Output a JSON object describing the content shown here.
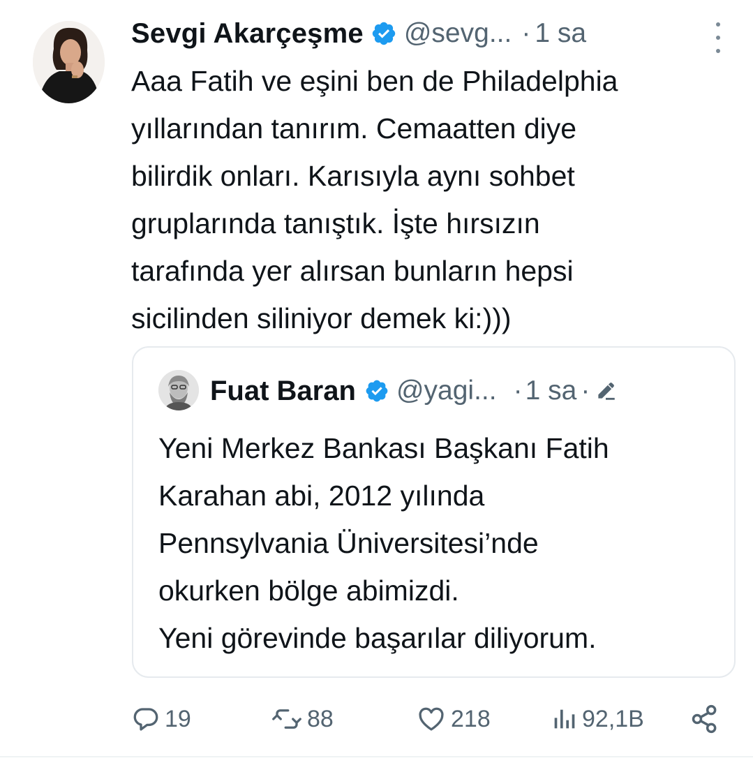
{
  "tweet": {
    "author_name": "Sevgi Akarçeşme",
    "author_handle": "@sevg...",
    "separator": "·",
    "time": "1 sa",
    "text_lines": [
      "Aaa Fatih ve eşini ben de Philadelphia",
      "yıllarından tanırım. Cemaatten diye",
      "bilirdik onları. Karısıyla aynı sohbet",
      "gruplarında tanıştık. İşte hırsızın",
      "tarafında yer alırsan bunların hepsi",
      "sicilinden siliniyor demek ki:)))"
    ],
    "icons": {
      "verified": "verified-badge-icon",
      "more": "more-options-icon"
    }
  },
  "quoted_tweet": {
    "author_name": "Fuat Baran",
    "author_handle": "@yagi...",
    "separator": "·",
    "time": "1 sa",
    "separator2": "·",
    "text_lines": [
      "Yeni Merkez Bankası Başkanı Fatih",
      "Karahan abi, 2012 yılında",
      "Pennsylvania Üniversitesi’nde",
      "okurken bölge abimizdi.",
      "Yeni görevinde başarılar diliyorum."
    ],
    "icons": {
      "verified": "verified-badge-icon",
      "edited": "edit-pencil-icon"
    }
  },
  "actions": {
    "replies": "19",
    "reposts": "88",
    "likes": "218",
    "views": "92,1B",
    "icons": [
      "reply-icon",
      "repost-icon",
      "like-icon",
      "views-icon",
      "share-icon"
    ]
  },
  "colors": {
    "text": "#0f1419",
    "secondary": "#536471",
    "verified": "#1d9bf0",
    "border": "#e6eaee"
  }
}
